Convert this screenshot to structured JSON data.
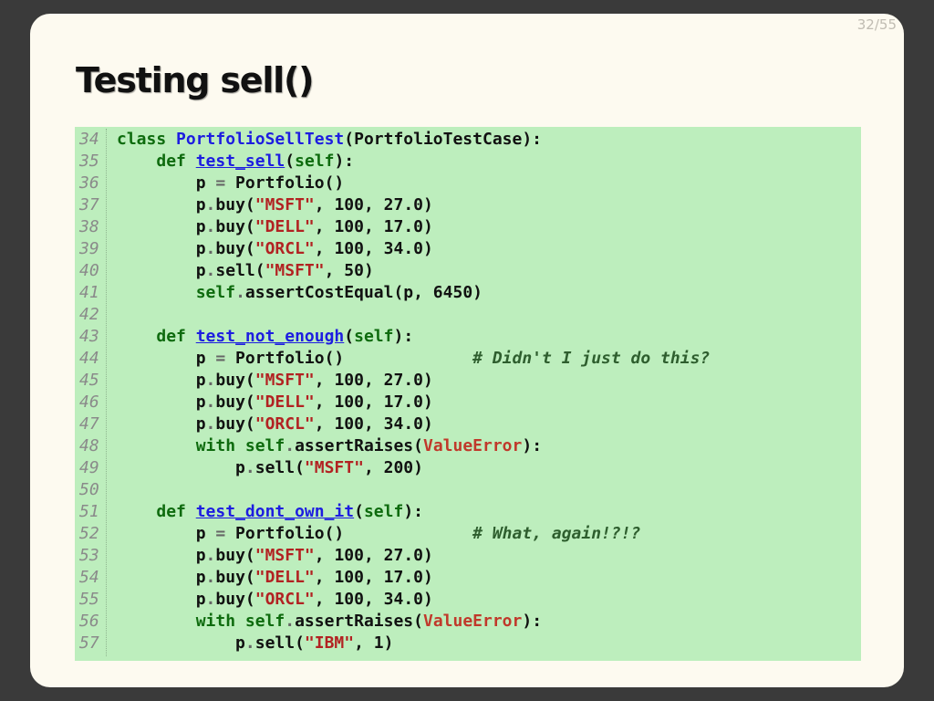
{
  "slide": {
    "counter": "32/55",
    "title": "Testing sell()"
  },
  "code": {
    "lines": [
      {
        "n": "34",
        "tokens": [
          [
            "kw",
            "class "
          ],
          [
            "cls",
            "PortfolioSellTest"
          ],
          [
            "",
            "(PortfolioTestCase):"
          ]
        ]
      },
      {
        "n": "35",
        "tokens": [
          [
            "",
            "    "
          ],
          [
            "kw",
            "def "
          ],
          [
            "fn",
            "test_sell"
          ],
          [
            "",
            "("
          ],
          [
            "kw",
            "self"
          ],
          [
            "",
            "):"
          ]
        ]
      },
      {
        "n": "36",
        "tokens": [
          [
            "",
            "        p "
          ],
          [
            "op",
            "="
          ],
          [
            "",
            " Portfolio()"
          ]
        ]
      },
      {
        "n": "37",
        "tokens": [
          [
            "",
            "        p"
          ],
          [
            "op",
            "."
          ],
          [
            "",
            "buy("
          ],
          [
            "str",
            "\"MSFT\""
          ],
          [
            "",
            ", 100, 27.0)"
          ]
        ]
      },
      {
        "n": "38",
        "tokens": [
          [
            "",
            "        p"
          ],
          [
            "op",
            "."
          ],
          [
            "",
            "buy("
          ],
          [
            "str",
            "\"DELL\""
          ],
          [
            "",
            ", 100, 17.0)"
          ]
        ]
      },
      {
        "n": "39",
        "tokens": [
          [
            "",
            "        p"
          ],
          [
            "op",
            "."
          ],
          [
            "",
            "buy("
          ],
          [
            "str",
            "\"ORCL\""
          ],
          [
            "",
            ", 100, 34.0)"
          ]
        ]
      },
      {
        "n": "40",
        "tokens": [
          [
            "",
            "        p"
          ],
          [
            "op",
            "."
          ],
          [
            "",
            "sell("
          ],
          [
            "str",
            "\"MSFT\""
          ],
          [
            "",
            ", 50)"
          ]
        ]
      },
      {
        "n": "41",
        "tokens": [
          [
            "",
            "        "
          ],
          [
            "kw",
            "self"
          ],
          [
            "op",
            "."
          ],
          [
            "",
            "assertCostEqual(p, 6450)"
          ]
        ]
      },
      {
        "n": "42",
        "tokens": []
      },
      {
        "n": "43",
        "tokens": [
          [
            "",
            "    "
          ],
          [
            "kw",
            "def "
          ],
          [
            "fn",
            "test_not_enough"
          ],
          [
            "",
            "("
          ],
          [
            "kw",
            "self"
          ],
          [
            "",
            "):"
          ]
        ]
      },
      {
        "n": "44",
        "tokens": [
          [
            "",
            "        p "
          ],
          [
            "op",
            "="
          ],
          [
            "",
            " Portfolio()             "
          ],
          [
            "cmt",
            "# Didn't I just do this?"
          ]
        ]
      },
      {
        "n": "45",
        "tokens": [
          [
            "",
            "        p"
          ],
          [
            "op",
            "."
          ],
          [
            "",
            "buy("
          ],
          [
            "str",
            "\"MSFT\""
          ],
          [
            "",
            ", 100, 27.0)"
          ]
        ]
      },
      {
        "n": "46",
        "tokens": [
          [
            "",
            "        p"
          ],
          [
            "op",
            "."
          ],
          [
            "",
            "buy("
          ],
          [
            "str",
            "\"DELL\""
          ],
          [
            "",
            ", 100, 17.0)"
          ]
        ]
      },
      {
        "n": "47",
        "tokens": [
          [
            "",
            "        p"
          ],
          [
            "op",
            "."
          ],
          [
            "",
            "buy("
          ],
          [
            "str",
            "\"ORCL\""
          ],
          [
            "",
            ", 100, 34.0)"
          ]
        ]
      },
      {
        "n": "48",
        "tokens": [
          [
            "",
            "        "
          ],
          [
            "kw",
            "with self"
          ],
          [
            "op",
            "."
          ],
          [
            "",
            "assertRaises("
          ],
          [
            "err",
            "ValueError"
          ],
          [
            "",
            "):"
          ]
        ]
      },
      {
        "n": "49",
        "tokens": [
          [
            "",
            "            p"
          ],
          [
            "op",
            "."
          ],
          [
            "",
            "sell("
          ],
          [
            "str",
            "\"MSFT\""
          ],
          [
            "",
            ", 200)"
          ]
        ]
      },
      {
        "n": "50",
        "tokens": []
      },
      {
        "n": "51",
        "tokens": [
          [
            "",
            "    "
          ],
          [
            "kw",
            "def "
          ],
          [
            "fn",
            "test_dont_own_it"
          ],
          [
            "",
            "("
          ],
          [
            "kw",
            "self"
          ],
          [
            "",
            "):"
          ]
        ]
      },
      {
        "n": "52",
        "tokens": [
          [
            "",
            "        p "
          ],
          [
            "op",
            "="
          ],
          [
            "",
            " Portfolio()             "
          ],
          [
            "cmt",
            "# What, again!?!?"
          ]
        ]
      },
      {
        "n": "53",
        "tokens": [
          [
            "",
            "        p"
          ],
          [
            "op",
            "."
          ],
          [
            "",
            "buy("
          ],
          [
            "str",
            "\"MSFT\""
          ],
          [
            "",
            ", 100, 27.0)"
          ]
        ]
      },
      {
        "n": "54",
        "tokens": [
          [
            "",
            "        p"
          ],
          [
            "op",
            "."
          ],
          [
            "",
            "buy("
          ],
          [
            "str",
            "\"DELL\""
          ],
          [
            "",
            ", 100, 17.0)"
          ]
        ]
      },
      {
        "n": "55",
        "tokens": [
          [
            "",
            "        p"
          ],
          [
            "op",
            "."
          ],
          [
            "",
            "buy("
          ],
          [
            "str",
            "\"ORCL\""
          ],
          [
            "",
            ", 100, 34.0)"
          ]
        ]
      },
      {
        "n": "56",
        "tokens": [
          [
            "",
            "        "
          ],
          [
            "kw",
            "with self"
          ],
          [
            "op",
            "."
          ],
          [
            "",
            "assertRaises("
          ],
          [
            "err",
            "ValueError"
          ],
          [
            "",
            "):"
          ]
        ]
      },
      {
        "n": "57",
        "tokens": [
          [
            "",
            "            p"
          ],
          [
            "op",
            "."
          ],
          [
            "",
            "sell("
          ],
          [
            "str",
            "\"IBM\""
          ],
          [
            "",
            ", 1)"
          ]
        ]
      }
    ]
  },
  "colors": {
    "page_background": "#3a3a3a",
    "slide_background": "#fdfaf0",
    "code_background": "#bdeebd",
    "keyword": "#0e6b0e",
    "function_name": "#1d1de0",
    "string": "#b22222",
    "comment": "#2e5e2e"
  }
}
